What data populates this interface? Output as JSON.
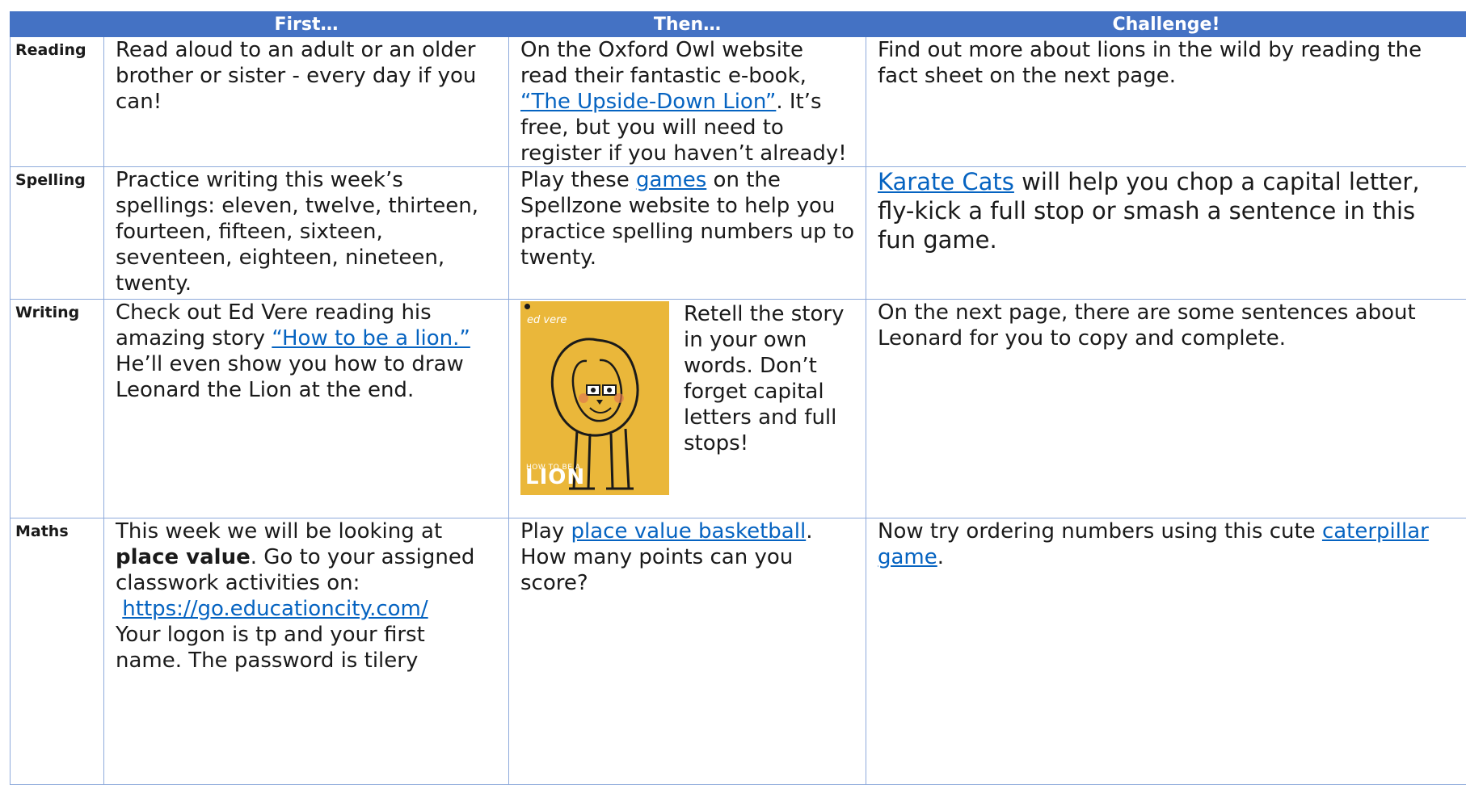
{
  "header": {
    "first": "First…",
    "then": "Then…",
    "challenge": "Challenge!"
  },
  "colors": {
    "header_bg": "#4472c4",
    "border": "#8eaadb",
    "link": "#0563c1",
    "cover_bg": "#eab73a"
  },
  "rows": {
    "reading": {
      "label": "Reading",
      "first": "Read aloud to an adult or an older brother or sister - every day if you can!",
      "then_pre": "On the Oxford Owl website read their fantastic e-book,",
      "then_link": "“The Upside-Down Lion”",
      "then_post": ".  It’s free, but you will need to register if you haven’t already!",
      "challenge": "Find out more about lions in the wild by reading the fact sheet on the next page."
    },
    "spelling": {
      "label": "Spelling",
      "first": "Practice writing this week’s spellings: eleven, twelve, thirteen, fourteen, fifteen, sixteen, seventeen, eighteen, nineteen, twenty.",
      "then_pre": "Play these",
      "then_link": "games",
      "then_post": " on the Spellzone website to help you practice spelling numbers up to twenty.",
      "challenge_link": "Karate Cats",
      "challenge_post": " will help you chop a capital letter, fly-kick a full stop or smash a sentence in this fun game."
    },
    "writing": {
      "label": "Writing",
      "first_pre": "Check out Ed Vere reading his amazing story",
      "first_link": "“How to be a lion.”",
      "first_post": " He’ll even show you how to draw Leonard the Lion at the end.",
      "book_author": "ed vere",
      "book_title_small": "HOW TO BE A",
      "book_title_big": "LION",
      "then_text": "Retell the story in your own words.  Don’t forget capital letters and full stops!",
      "challenge": "On the next page, there are some sentences about Leonard for you to copy and complete."
    },
    "maths": {
      "label": "Maths",
      "first_pre": "This week we will be looking at",
      "first_bold": "place value",
      "first_mid": ".  Go to your assigned classwork activities on:",
      "first_link": "https://go.educationcity.com/",
      "first_post": "Your logon is tp and your first name. The password is tilery",
      "then_pre": "Play",
      "then_link": "place value basketball",
      "then_post": ". How many points can you score?",
      "challenge_pre": "Now try ordering numbers using this cute",
      "challenge_link": "caterpillar game",
      "challenge_post": "."
    }
  }
}
